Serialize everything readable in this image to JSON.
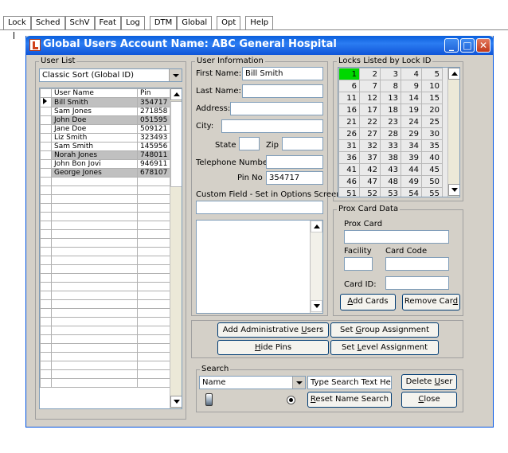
{
  "menu_tabs": [
    "Lock",
    "Sched",
    "SchV",
    "Feat",
    "Log",
    "DTM",
    "Global",
    "Opt",
    "Help"
  ],
  "window": {
    "title": "Global Users Account Name: ABC General Hospital"
  },
  "user_list": {
    "legend": "User List",
    "sort": "Classic Sort (Global ID)",
    "col_name": "User Name",
    "col_pin": "Pin",
    "rows": [
      {
        "name": "Bill Smith",
        "pin": "354717",
        "hl": true,
        "current": true
      },
      {
        "name": "Sam Jones",
        "pin": "271858",
        "hl": false
      },
      {
        "name": "John Doe",
        "pin": "051595",
        "hl": true
      },
      {
        "name": "Jane Doe",
        "pin": "509121",
        "hl": false
      },
      {
        "name": "Liz Smith",
        "pin": "323493",
        "hl": false
      },
      {
        "name": "Sam Smith",
        "pin": "145956",
        "hl": false
      },
      {
        "name": "Norah Jones",
        "pin": "748011",
        "hl": true
      },
      {
        "name": "John Bon Jovi",
        "pin": "946911",
        "hl": false
      },
      {
        "name": "George Jones",
        "pin": "678107",
        "hl": true
      }
    ]
  },
  "user_info": {
    "legend": "User Information",
    "first_name_label": "First Name:",
    "first_name": "Bill Smith",
    "last_name_label": "Last Name:",
    "last_name": "",
    "address_label": "Address:",
    "city_label": "City:",
    "state_label": "State",
    "zip_label": "Zip",
    "phone_label": "Telephone Number:",
    "pin_label": "Pin No",
    "pin": "354717",
    "custom_label": "Custom Field - Set in Options Screen"
  },
  "locks": {
    "legend": "Locks Listed by Lock ID",
    "rows": [
      [
        "1",
        "2",
        "3",
        "4",
        "5"
      ],
      [
        "6",
        "7",
        "8",
        "9",
        "10"
      ],
      [
        "11",
        "12",
        "13",
        "14",
        "15"
      ],
      [
        "16",
        "17",
        "18",
        "19",
        "20"
      ],
      [
        "21",
        "22",
        "23",
        "24",
        "25"
      ],
      [
        "26",
        "27",
        "28",
        "29",
        "30"
      ],
      [
        "31",
        "32",
        "33",
        "34",
        "35"
      ],
      [
        "36",
        "37",
        "38",
        "39",
        "40"
      ],
      [
        "41",
        "42",
        "43",
        "44",
        "45"
      ],
      [
        "46",
        "47",
        "48",
        "49",
        "50"
      ],
      [
        "51",
        "52",
        "53",
        "54",
        "55"
      ]
    ],
    "selected_color": "#00d800"
  },
  "prox": {
    "legend": "Prox Card Data",
    "prox_label": "Prox Card",
    "facility_label": "Facility",
    "card_code_label": "Card Code",
    "card_id_label": "Card ID:",
    "add_cards_pre": "",
    "add_cards_u": "A",
    "add_cards_post": "dd Cards",
    "remove_card_pre": "Remove Car",
    "remove_card_u": "d",
    "remove_card_post": ""
  },
  "actions": {
    "add_admin_pre": "Add Administrative ",
    "add_admin_u": "U",
    "add_admin_post": "sers",
    "set_group_pre": "Set ",
    "set_group_u": "G",
    "set_group_post": "roup Assignment",
    "hide_pins_pre": "",
    "hide_pins_u": "H",
    "hide_pins_post": "ide Pins",
    "set_level_pre": "Set ",
    "set_level_u": "L",
    "set_level_post": "evel Assignment"
  },
  "search": {
    "legend": "Search",
    "field": "Name",
    "text": "Type Search Text Here",
    "reset_pre": "",
    "reset_u": "R",
    "reset_post": "eset Name Search",
    "delete_pre": "Delete ",
    "delete_u": "U",
    "delete_post": "ser",
    "close_pre": "",
    "close_u": "C",
    "close_post": "lose"
  }
}
